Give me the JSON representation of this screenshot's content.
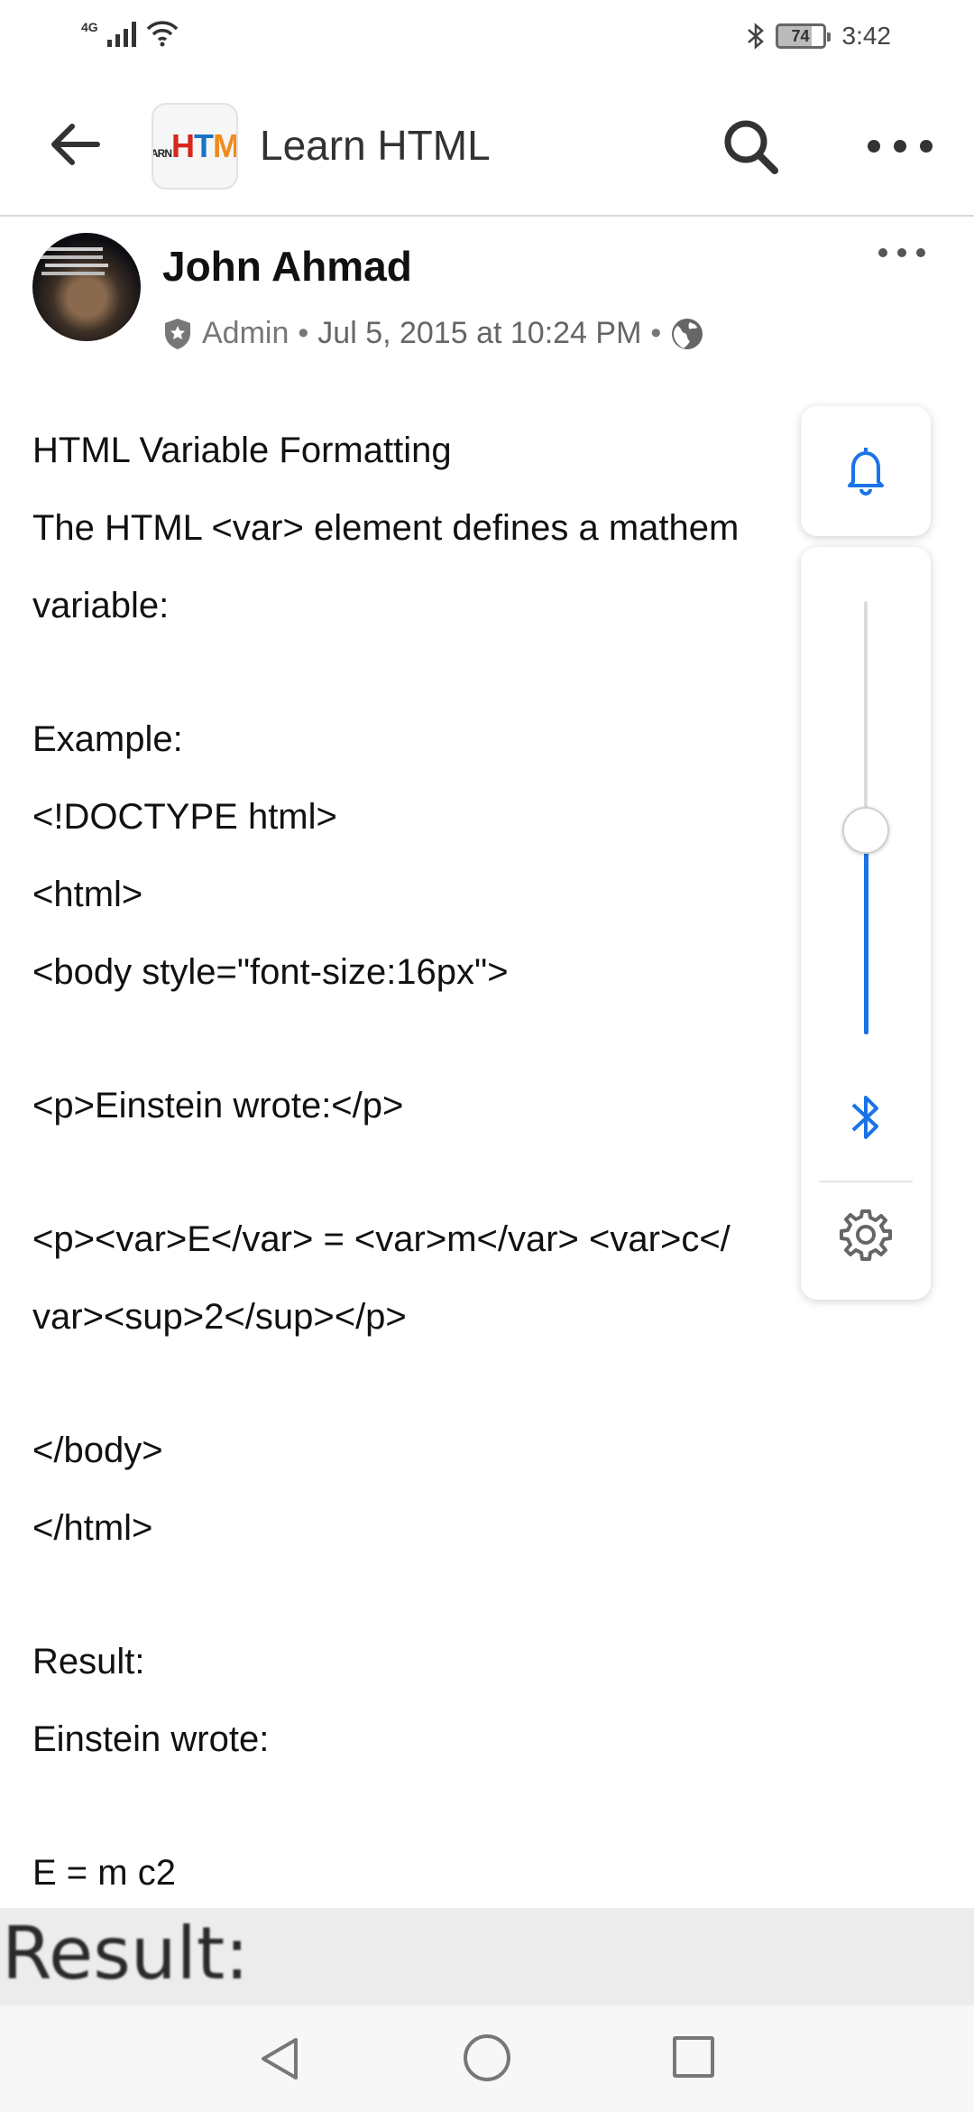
{
  "status_bar": {
    "network": "4G",
    "battery": "74",
    "time": "3:42"
  },
  "app_bar": {
    "title": "Learn HTML",
    "logo": "LEARN HTML"
  },
  "post": {
    "author": "John Ahmad",
    "role": "Admin",
    "separator": "•",
    "date": "Jul 5, 2015 at 10:24 PM",
    "lines": [
      "HTML Variable Formatting",
      "The HTML <var> element defines a mathem",
      "variable:",
      "",
      "Example:",
      "<!DOCTYPE html>",
      "<html>",
      "<body style=\"font-size:16px\">",
      "",
      "<p>Einstein wrote:</p>",
      "",
      "<p><var>E</var> = <var>m</var> <var>c</",
      "var><sup>2</sup></p>",
      "",
      "</body>",
      "</html>",
      "",
      "Result:",
      "Einstein wrote:",
      "",
      "E = m c2"
    ]
  },
  "volume_panel": {
    "level": 0.47
  },
  "overlay": {
    "result_text": "Result:"
  }
}
